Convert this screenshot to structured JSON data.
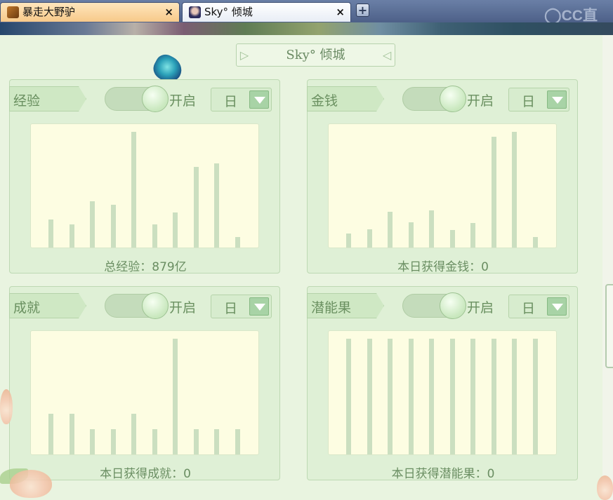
{
  "browser": {
    "tabs": [
      {
        "label": "暴走大野驴",
        "close": "×",
        "active": false
      },
      {
        "label": "Sky° 倾城",
        "close": "×",
        "active": true
      }
    ],
    "new_tab": "+",
    "logo_text": "CC直"
  },
  "panel": {
    "title": "Sky° 倾城"
  },
  "cards": [
    {
      "tag": "经验",
      "toggle_label": "开启",
      "select_value": "日",
      "summary": "总经验：879亿",
      "bars": [
        0.24,
        0.2,
        0.4,
        0.37,
        1.0,
        0.2,
        0.3,
        0.7,
        0.73,
        0.09
      ]
    },
    {
      "tag": "金钱",
      "toggle_label": "开启",
      "select_value": "日",
      "summary": "本日获得金钱：0",
      "bars": [
        0.12,
        0.16,
        0.31,
        0.22,
        0.32,
        0.15,
        0.21,
        0.96,
        1.0,
        0.09
      ]
    },
    {
      "tag": "成就",
      "toggle_label": "开启",
      "select_value": "日",
      "summary": "本日获得成就：0",
      "bars": [
        0.35,
        0.35,
        0.22,
        0.22,
        0.35,
        0.22,
        1.0,
        0.22,
        0.22,
        0.22
      ]
    },
    {
      "tag": "潜能果",
      "toggle_label": "开启",
      "select_value": "日",
      "summary": "本日获得潜能果：0",
      "bars": [
        1.0,
        1.0,
        1.0,
        1.0,
        1.0,
        1.0,
        1.0,
        1.0,
        1.0,
        1.0
      ]
    }
  ],
  "colors": {
    "bar": "#cbdfc0",
    "chart_bg": "#fdfde2",
    "card_bg": "#dff0d6",
    "text": "#6a8e62",
    "active_tab": "#f7c98a"
  }
}
